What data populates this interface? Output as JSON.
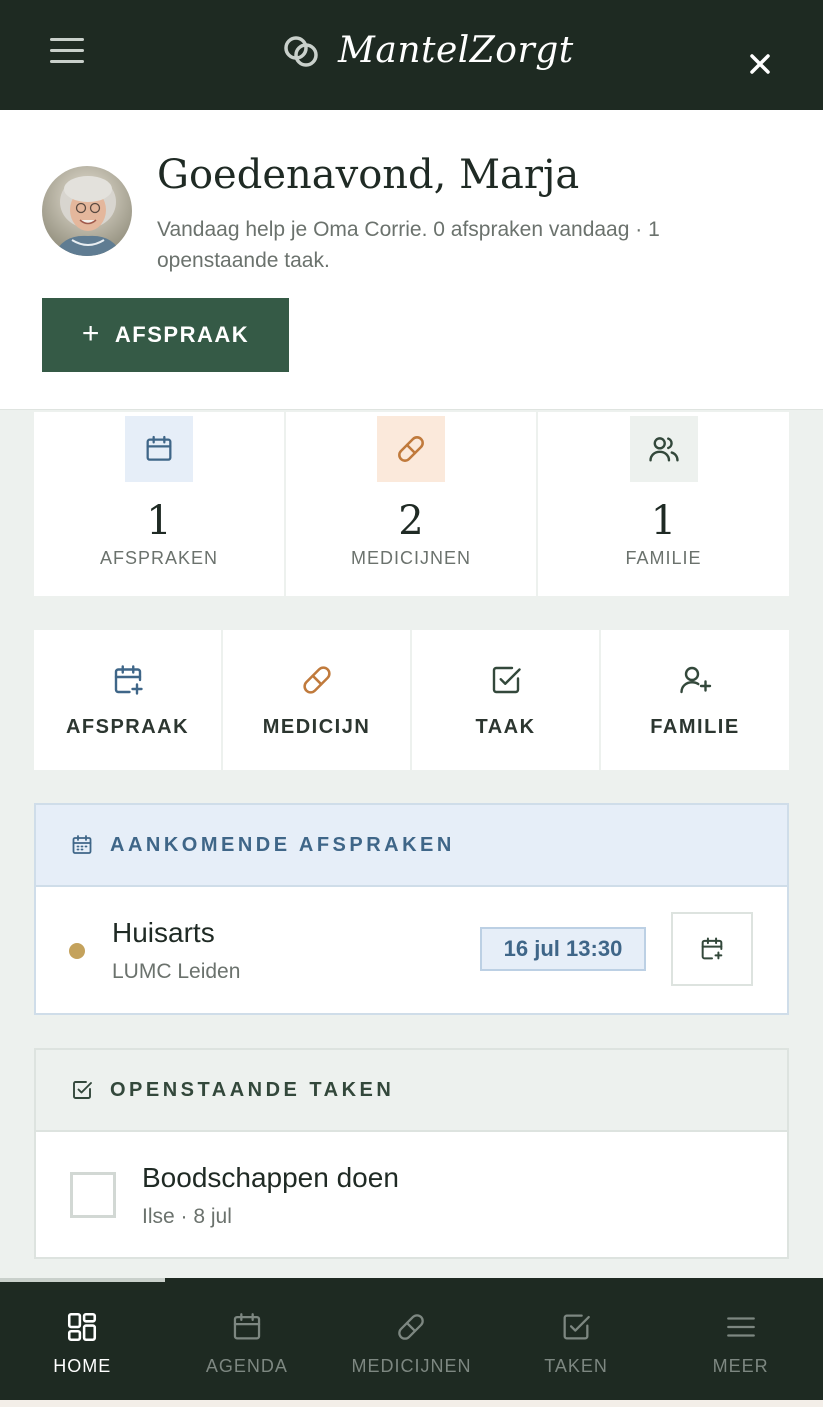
{
  "header": {
    "app_name": "MantelZorgt",
    "menu_icon": "hamburger-icon",
    "logo_icon": "linked-circles-icon",
    "close_icon": "close-icon"
  },
  "hero": {
    "greeting": "Goedenavond, Marja",
    "subtitle": "Vandaag help je Oma Corrie. 0 afspraken vandaag · 1 openstaande taak.",
    "add_button": {
      "icon": "+",
      "label": "AFSPRAAK"
    }
  },
  "stats": [
    {
      "icon": "calendar-icon",
      "value": "1",
      "label": "AFSPRAKEN",
      "bg": "#e6eef8",
      "color": "#3f6688"
    },
    {
      "icon": "pill-icon",
      "value": "2",
      "label": "MEDICIJNEN",
      "bg": "#fbe9db",
      "color": "#c07a3c"
    },
    {
      "icon": "users-icon",
      "value": "1",
      "label": "FAMILIE",
      "bg": "#edf1ee",
      "color": "#33483b"
    }
  ],
  "quick_actions": [
    {
      "icon": "calendar-plus-icon",
      "label": "AFSPRAAK"
    },
    {
      "icon": "pill-icon",
      "label": "MEDICIJN"
    },
    {
      "icon": "checkbox-icon",
      "label": "TAAK"
    },
    {
      "icon": "user-plus-icon",
      "label": "FAMILIE"
    }
  ],
  "appointments": {
    "title": "AANKOMENDE AFSPRAKEN",
    "items": [
      {
        "title": "Huisarts",
        "location": "LUMC Leiden",
        "date": "16 jul 13:30"
      }
    ]
  },
  "tasks": {
    "title": "OPENSTAANDE TAKEN",
    "items": [
      {
        "title": "Boodschappen doen",
        "meta": "Ilse · 8 jul"
      }
    ]
  },
  "bottom_nav": [
    {
      "icon": "grid-icon",
      "label": "HOME",
      "active": true
    },
    {
      "icon": "calendar-icon",
      "label": "AGENDA",
      "active": false
    },
    {
      "icon": "pill-icon",
      "label": "MEDICIJNEN",
      "active": false
    },
    {
      "icon": "checkbox-icon",
      "label": "TAKEN",
      "active": false
    },
    {
      "icon": "hamburger-icon",
      "label": "MEER",
      "active": false
    }
  ],
  "colors": {
    "header_bg": "#1e2a22",
    "primary_green": "#355a46",
    "appointment_blue": "#3f6688",
    "medication_orange": "#c07a3c",
    "appointment_dot": "#c4a25c"
  }
}
